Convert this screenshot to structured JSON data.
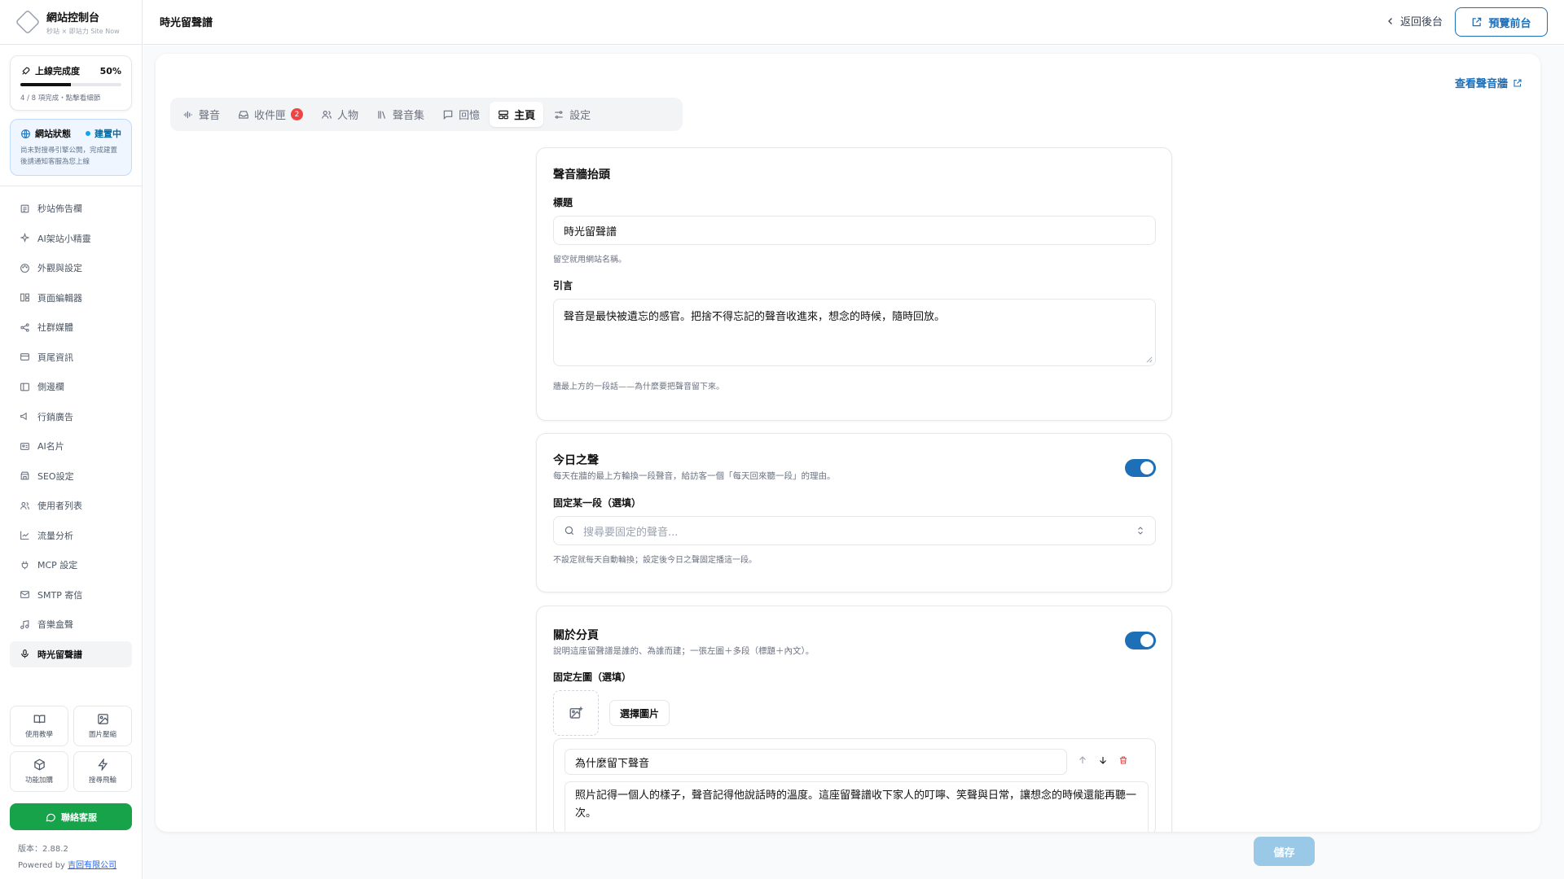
{
  "brand": {
    "title": "網站控制台",
    "subtitle": "秒站 × 即站力 Site Now"
  },
  "progress": {
    "label": "上線完成度",
    "percent": "50%",
    "fraction": 0.5,
    "hint": "4 / 8 項完成・點擊看細節"
  },
  "site_status": {
    "label": "網站狀態",
    "value": "建置中",
    "description": "尚未對搜尋引擎公開，完成建置後請通知客服為您上線"
  },
  "nav": [
    {
      "label": "秒站佈告欄",
      "icon": "newspaper-icon"
    },
    {
      "label": "AI架站小精靈",
      "icon": "sparkle-icon"
    },
    {
      "label": "外觀與設定",
      "icon": "palette-icon"
    },
    {
      "label": "頁面編輯器",
      "icon": "layout-icon"
    },
    {
      "label": "社群媒體",
      "icon": "share-icon"
    },
    {
      "label": "頁尾資訊",
      "icon": "card-icon"
    },
    {
      "label": "側邊欄",
      "icon": "sidebar-icon"
    },
    {
      "label": "行銷廣告",
      "icon": "megaphone-icon"
    },
    {
      "label": "AI名片",
      "icon": "id-card-icon"
    },
    {
      "label": "SEO設定",
      "icon": "store-icon"
    },
    {
      "label": "使用者列表",
      "icon": "users-icon"
    },
    {
      "label": "流量分析",
      "icon": "chart-icon"
    },
    {
      "label": "MCP 設定",
      "icon": "plug-icon"
    },
    {
      "label": "SMTP 寄信",
      "icon": "mail-icon"
    },
    {
      "label": "音樂盒聲",
      "icon": "music-icon"
    },
    {
      "label": "時光留聲譜",
      "icon": "mic-icon",
      "active": true
    }
  ],
  "tools": [
    {
      "label": "使用教學",
      "icon": "book-icon"
    },
    {
      "label": "圖片壓縮",
      "icon": "image-icon"
    },
    {
      "label": "功能加購",
      "icon": "box-icon"
    },
    {
      "label": "搜尋飛輪",
      "icon": "bolt-icon"
    }
  ],
  "contact_label": "聯絡客服",
  "version": "版本：2.88.2",
  "powered_prefix": "Powered by ",
  "powered_link": "吉回有限公司",
  "header": {
    "title": "時光留聲譜",
    "back": "返回後台",
    "preview": "預覽前台"
  },
  "view_link": "查看聲音牆",
  "tabs": [
    {
      "label": "聲音",
      "icon": "waveform-icon"
    },
    {
      "label": "收件匣",
      "icon": "inbox-icon",
      "badge": "2"
    },
    {
      "label": "人物",
      "icon": "people-icon"
    },
    {
      "label": "聲音集",
      "icon": "library-icon"
    },
    {
      "label": "回憶",
      "icon": "message-icon"
    },
    {
      "label": "主頁",
      "icon": "home-layout-icon",
      "active": true
    },
    {
      "label": "設定",
      "icon": "sliders-icon"
    }
  ],
  "hero": {
    "title": "聲音牆抬頭",
    "title_label": "標題",
    "title_value": "時光留聲譜",
    "title_help": "留空就用網站名稱。",
    "quote_label": "引言",
    "quote_value": "聲音是最快被遺忘的感官。把捨不得忘記的聲音收進來，想念的時候，隨時回放。",
    "quote_help": "牆最上方的一段話——為什麼要把聲音留下來。"
  },
  "today": {
    "title": "今日之聲",
    "description": "每天在牆的最上方輪換一段聲音，給訪客一個「每天回來聽一段」的理由。",
    "enabled": true,
    "pin_label": "固定某一段（選填）",
    "search_placeholder": "搜尋要固定的聲音...",
    "help": "不設定就每天自動輪換；設定後今日之聲固定播這一段。"
  },
  "about": {
    "title": "關於分頁",
    "description": "說明這座留聲譜是誰的、為誰而建；一張左圖＋多段（標題＋內文）。",
    "enabled": true,
    "image_label": "固定左圖（選填）",
    "choose_image": "選擇圖片",
    "section_title": "為什麼留下聲音",
    "section_body": "照片記得一個人的樣子，聲音記得他說話時的溫度。這座留聲譜收下家人的叮嚀、笑聲與日常，讓想念的時候還能再聽一次。"
  },
  "save_label": "儲存",
  "colors": {
    "accent": "#1d6fb8",
    "contact_green": "#16a34a",
    "badge_red": "#ef4444",
    "status_blue": "#0369a1"
  }
}
